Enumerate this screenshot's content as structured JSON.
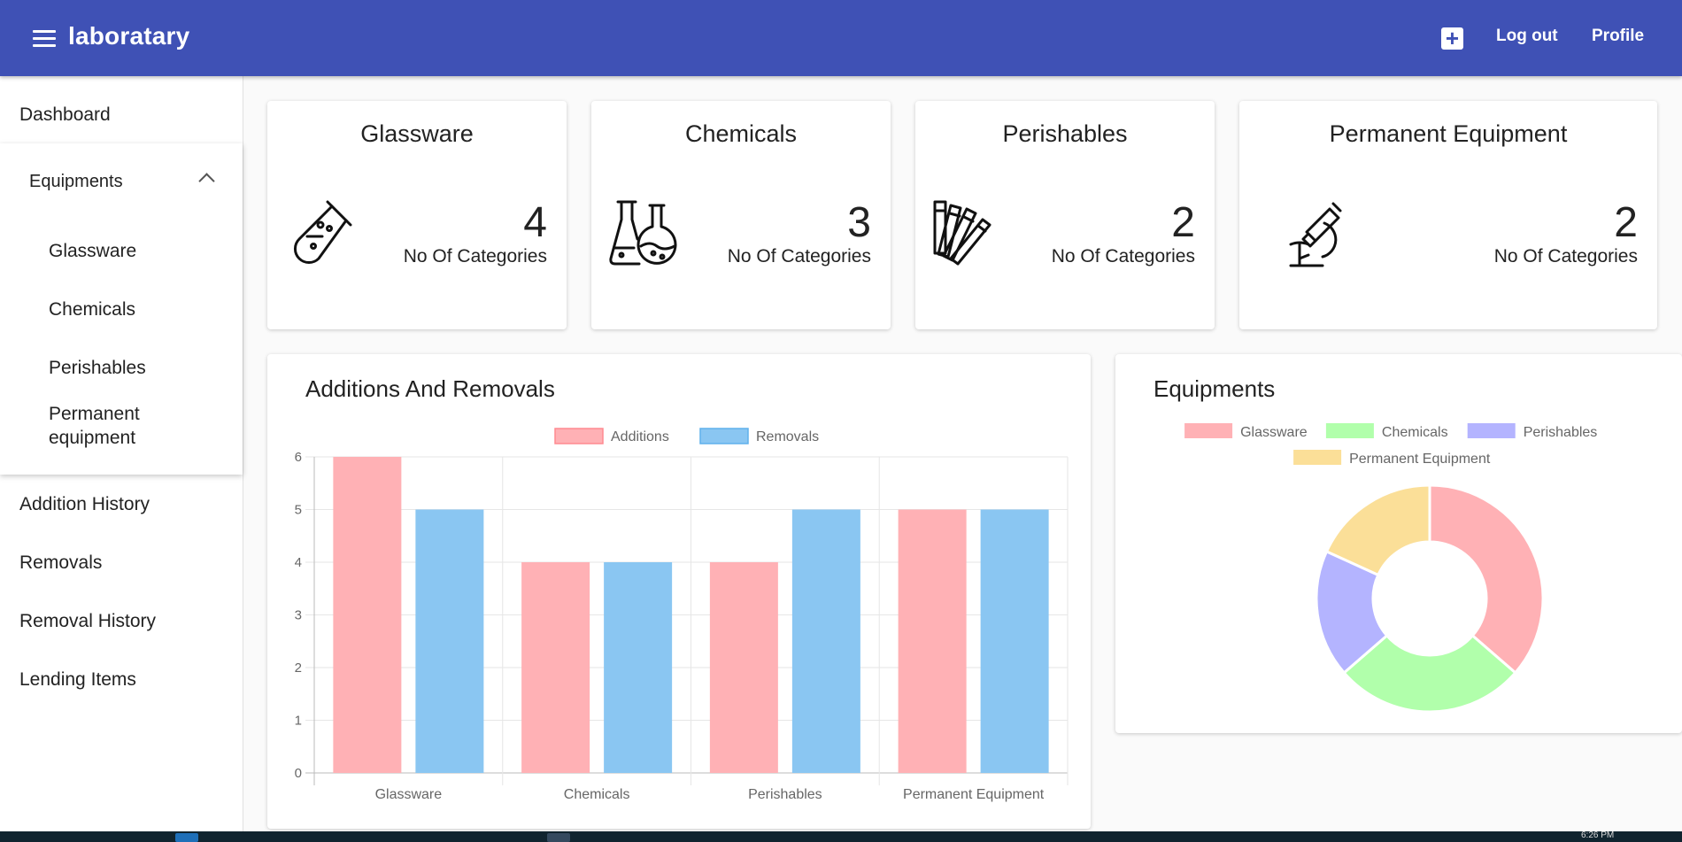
{
  "app": {
    "title": "laboratary"
  },
  "header": {
    "add_icon": "plus-box-icon",
    "logout_label": "Log out",
    "profile_label": "Profile"
  },
  "sidebar": {
    "dashboard": "Dashboard",
    "equipments": {
      "label": "Equipments",
      "expanded": true,
      "items": [
        "Glassware",
        "Chemicals",
        "Perishables",
        "Permanent equipment"
      ]
    },
    "items": [
      "Addition History",
      "Removals",
      "Removal History",
      "Lending Items"
    ]
  },
  "cards": [
    {
      "title": "Glassware",
      "count": "4",
      "label": "No Of Categories",
      "icon": "test-tube-icon"
    },
    {
      "title": "Chemicals",
      "count": "3",
      "label": "No Of Categories",
      "icon": "flasks-icon"
    },
    {
      "title": "Perishables",
      "count": "2",
      "label": "No Of Categories",
      "icon": "sample-strips-icon"
    },
    {
      "title": "Permanent Equipment",
      "count": "2",
      "label": "No Of Categories",
      "icon": "microscope-icon"
    }
  ],
  "bar_panel": {
    "title": "Additions And Removals"
  },
  "pie_panel": {
    "title": "Equipments"
  },
  "chart_data": [
    {
      "type": "bar",
      "title": "",
      "categories": [
        "Glassware",
        "Chemicals",
        "Perishables",
        "Permanent Equipment"
      ],
      "series": [
        {
          "name": "Additions",
          "values": [
            6,
            4,
            4,
            5
          ],
          "color": "#ffb1b5"
        },
        {
          "name": "Removals",
          "values": [
            5,
            4,
            5,
            5
          ],
          "color": "#8ac6f2"
        }
      ],
      "ylim": [
        0,
        6
      ],
      "yticks": [
        "0",
        "1",
        "2",
        "3",
        "4",
        "5",
        "6"
      ],
      "grid": true,
      "legend": "top-center"
    },
    {
      "type": "pie",
      "variant": "doughnut",
      "title": "",
      "labels": [
        "Glassware",
        "Chemicals",
        "Perishables",
        "Permanent Equipment"
      ],
      "values": [
        4,
        3,
        2,
        2
      ],
      "colors": [
        "#ffb1b5",
        "#b1ffab",
        "#b4b4ff",
        "#fbdf98"
      ],
      "legend": "top-center"
    }
  ],
  "taskbar": {
    "time": "6:26 PM"
  }
}
